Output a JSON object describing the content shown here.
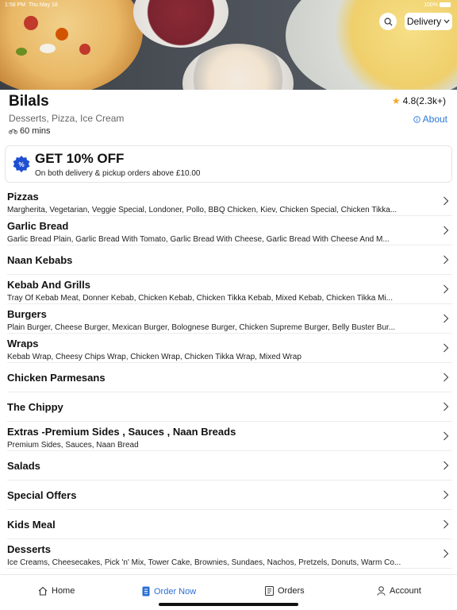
{
  "status_bar": {
    "time": "1:58 PM",
    "date": "Thu May 18",
    "battery": "100%"
  },
  "header": {
    "mode_select": "Delivery"
  },
  "restaurant": {
    "name": "Bilals",
    "rating": "4.8(2.3k+)",
    "cuisines": "Desserts, Pizza, Ice Cream",
    "about_label": "About",
    "delivery_time": "60 mins"
  },
  "offer": {
    "title": "GET 10% OFF",
    "subtitle": "On both delivery & pickup orders above £10.00"
  },
  "menu": [
    {
      "name": "Pizzas",
      "items": "Margherita, Vegetarian, Veggie Special, Londoner, Pollo, BBQ Chicken, Kiev, Chicken Special, Chicken Tikka..."
    },
    {
      "name": "Garlic Bread",
      "items": "Garlic Bread Plain, Garlic Bread With Tomato, Garlic Bread With Cheese, Garlic Bread With Cheese And M..."
    },
    {
      "name": "Naan Kebabs",
      "items": ""
    },
    {
      "name": "Kebab And Grills",
      "items": "Tray Of Kebab Meat, Donner Kebab, Chicken Kebab, Chicken Tikka Kebab, Mixed Kebab, Chicken Tikka Mi..."
    },
    {
      "name": "Burgers",
      "items": "Plain Burger, Cheese Burger, Mexican Burger, Bolognese Burger, Chicken Supreme Burger, Belly Buster Bur..."
    },
    {
      "name": "Wraps",
      "items": "Kebab Wrap, Cheesy Chips Wrap, Chicken Wrap, Chicken Tikka Wrap, Mixed Wrap"
    },
    {
      "name": "Chicken Parmesans",
      "items": ""
    },
    {
      "name": "The Chippy",
      "items": ""
    },
    {
      "name": "Extras -Premium Sides , Sauces , Naan Breads",
      "items": "Premium Sides, Sauces, Naan Bread"
    },
    {
      "name": "Salads",
      "items": ""
    },
    {
      "name": "Special Offers",
      "items": ""
    },
    {
      "name": "Kids Meal",
      "items": ""
    },
    {
      "name": "Desserts",
      "items": "Ice Creams, Cheesecakes, Pick 'n' Mix, Tower Cake, Brownies, Sundaes, Nachos, Pretzels, Donuts, Warm Co..."
    }
  ],
  "nav": {
    "home": "Home",
    "order_now": "Order Now",
    "orders": "Orders",
    "account": "Account"
  },
  "colors": {
    "accent": "#2a6fd6",
    "badge": "#1f4fd1",
    "star": "#f5a623"
  },
  "icons": [
    "search-icon",
    "chevron-down-icon",
    "star-icon",
    "info-icon",
    "bike-icon",
    "discount-badge-icon",
    "chevron-right-icon",
    "home-icon",
    "menu-book-icon",
    "receipt-icon",
    "person-icon"
  ]
}
